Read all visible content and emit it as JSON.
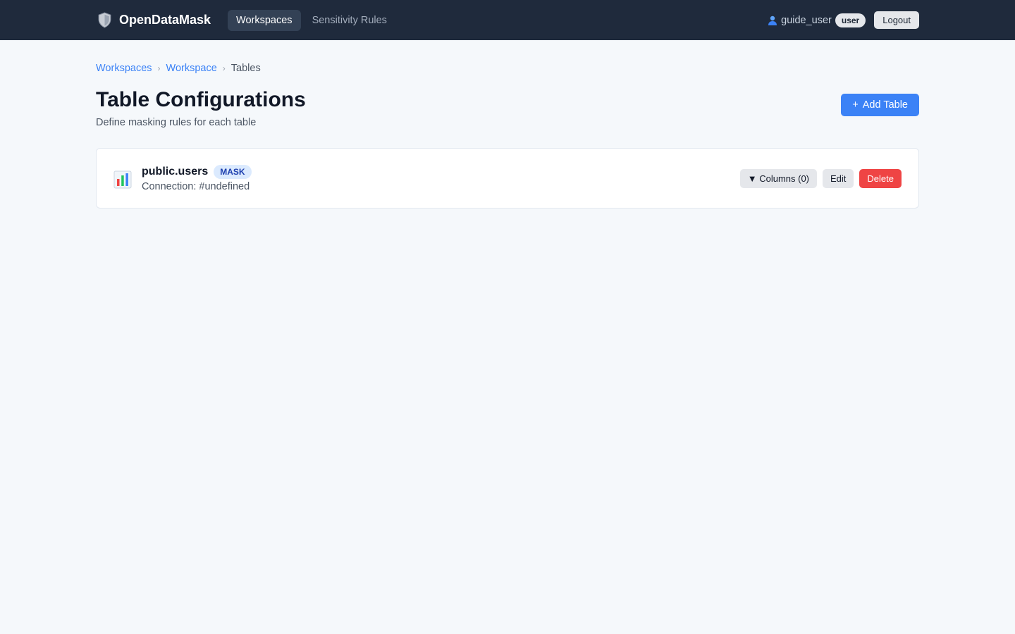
{
  "app": {
    "brand": "OpenDataMask"
  },
  "nav": {
    "items": [
      {
        "label": "Workspaces",
        "active": true
      },
      {
        "label": "Sensitivity Rules",
        "active": false
      }
    ]
  },
  "user": {
    "name": "guide_user",
    "role": "user",
    "logout_label": "Logout"
  },
  "breadcrumb": {
    "items": [
      "Workspaces",
      "Workspace"
    ],
    "current": "Tables",
    "separator": "›"
  },
  "page": {
    "title": "Table Configurations",
    "subtitle": "Define masking rules for each table",
    "add_button_label": "Add Table",
    "add_button_icon": "+"
  },
  "tables": [
    {
      "name": "public.users",
      "mode": "MASK",
      "connection": "Connection: #undefined",
      "columns_label": "▼ Columns (0)",
      "edit_label": "Edit",
      "delete_label": "Delete"
    }
  ],
  "colors": {
    "topbar": "#1f2a3c",
    "accent": "#3b82f6",
    "danger": "#ef4444",
    "background": "#f5f8fb"
  },
  "icons": {
    "brand": "shield-icon",
    "user": "user-icon",
    "table": "bar-chart-icon"
  }
}
